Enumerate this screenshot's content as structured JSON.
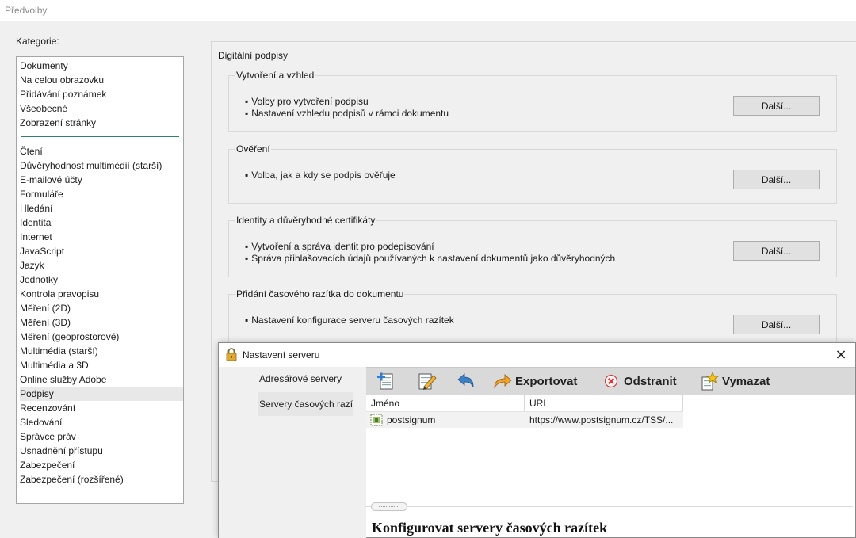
{
  "window": {
    "title": "Předvolby"
  },
  "categories": {
    "label": "Kategorie:",
    "items": [
      "Dokumenty",
      "Na celou obrazovku",
      "Přidávání poznámek",
      "Všeobecné",
      "Zobrazení stránky",
      "Čtení",
      "Důvěryhodnost multimédií (starší)",
      "E-mailové účty",
      "Formuláře",
      "Hledání",
      "Identita",
      "Internet",
      "JavaScript",
      "Jazyk",
      "Jednotky",
      "Kontrola pravopisu",
      "Měření (2D)",
      "Měření (3D)",
      "Měření (geoprostorové)",
      "Multimédia (starší)",
      "Multimédia a 3D",
      "Online služby Adobe",
      "Podpisy",
      "Recenzování",
      "Sledování",
      "Správce práv",
      "Usnadnění přístupu",
      "Zabezpečení",
      "Zabezpečení (rozšířené)"
    ],
    "selected": "Podpisy"
  },
  "signatures": {
    "title": "Digitální podpisy",
    "groups": [
      {
        "title": "Vytvoření a vzhled",
        "bullets": [
          "Volby pro vytvoření podpisu",
          "Nastavení vzhledu podpisů v rámci dokumentu"
        ],
        "button": "Další..."
      },
      {
        "title": "Ověření",
        "bullets": [
          "Volba, jak a kdy se podpis ověřuje"
        ],
        "button": "Další..."
      },
      {
        "title": "Identity a důvěryhodné certifikáty",
        "bullets": [
          "Vytvoření a správa identit pro podepisování",
          "Správa přihlašovacích údajů používaných k nastavení dokumentů jako důvěryhodných"
        ],
        "button": "Další..."
      },
      {
        "title": "Přidání časového razítka do dokumentu",
        "bullets": [
          "Nastavení konfigurace serveru časových razítek"
        ],
        "button": "Další..."
      }
    ]
  },
  "dialog": {
    "title": "Nastavení serveru",
    "close_icon": "×",
    "sidebar": [
      "Adresářové servery",
      "Servery časových razítek"
    ],
    "selected": "Servery časových razítek",
    "toolbar": {
      "export": "Exportovat",
      "remove": "Odstranit",
      "clear": "Vymazat"
    },
    "table": {
      "headers": [
        "Jméno",
        "URL"
      ],
      "rows": [
        {
          "name": "postsignum",
          "url": "https://www.postsignum.cz/TSS/..."
        }
      ]
    },
    "config_title": "Konfigurovat servery časových razítek"
  }
}
